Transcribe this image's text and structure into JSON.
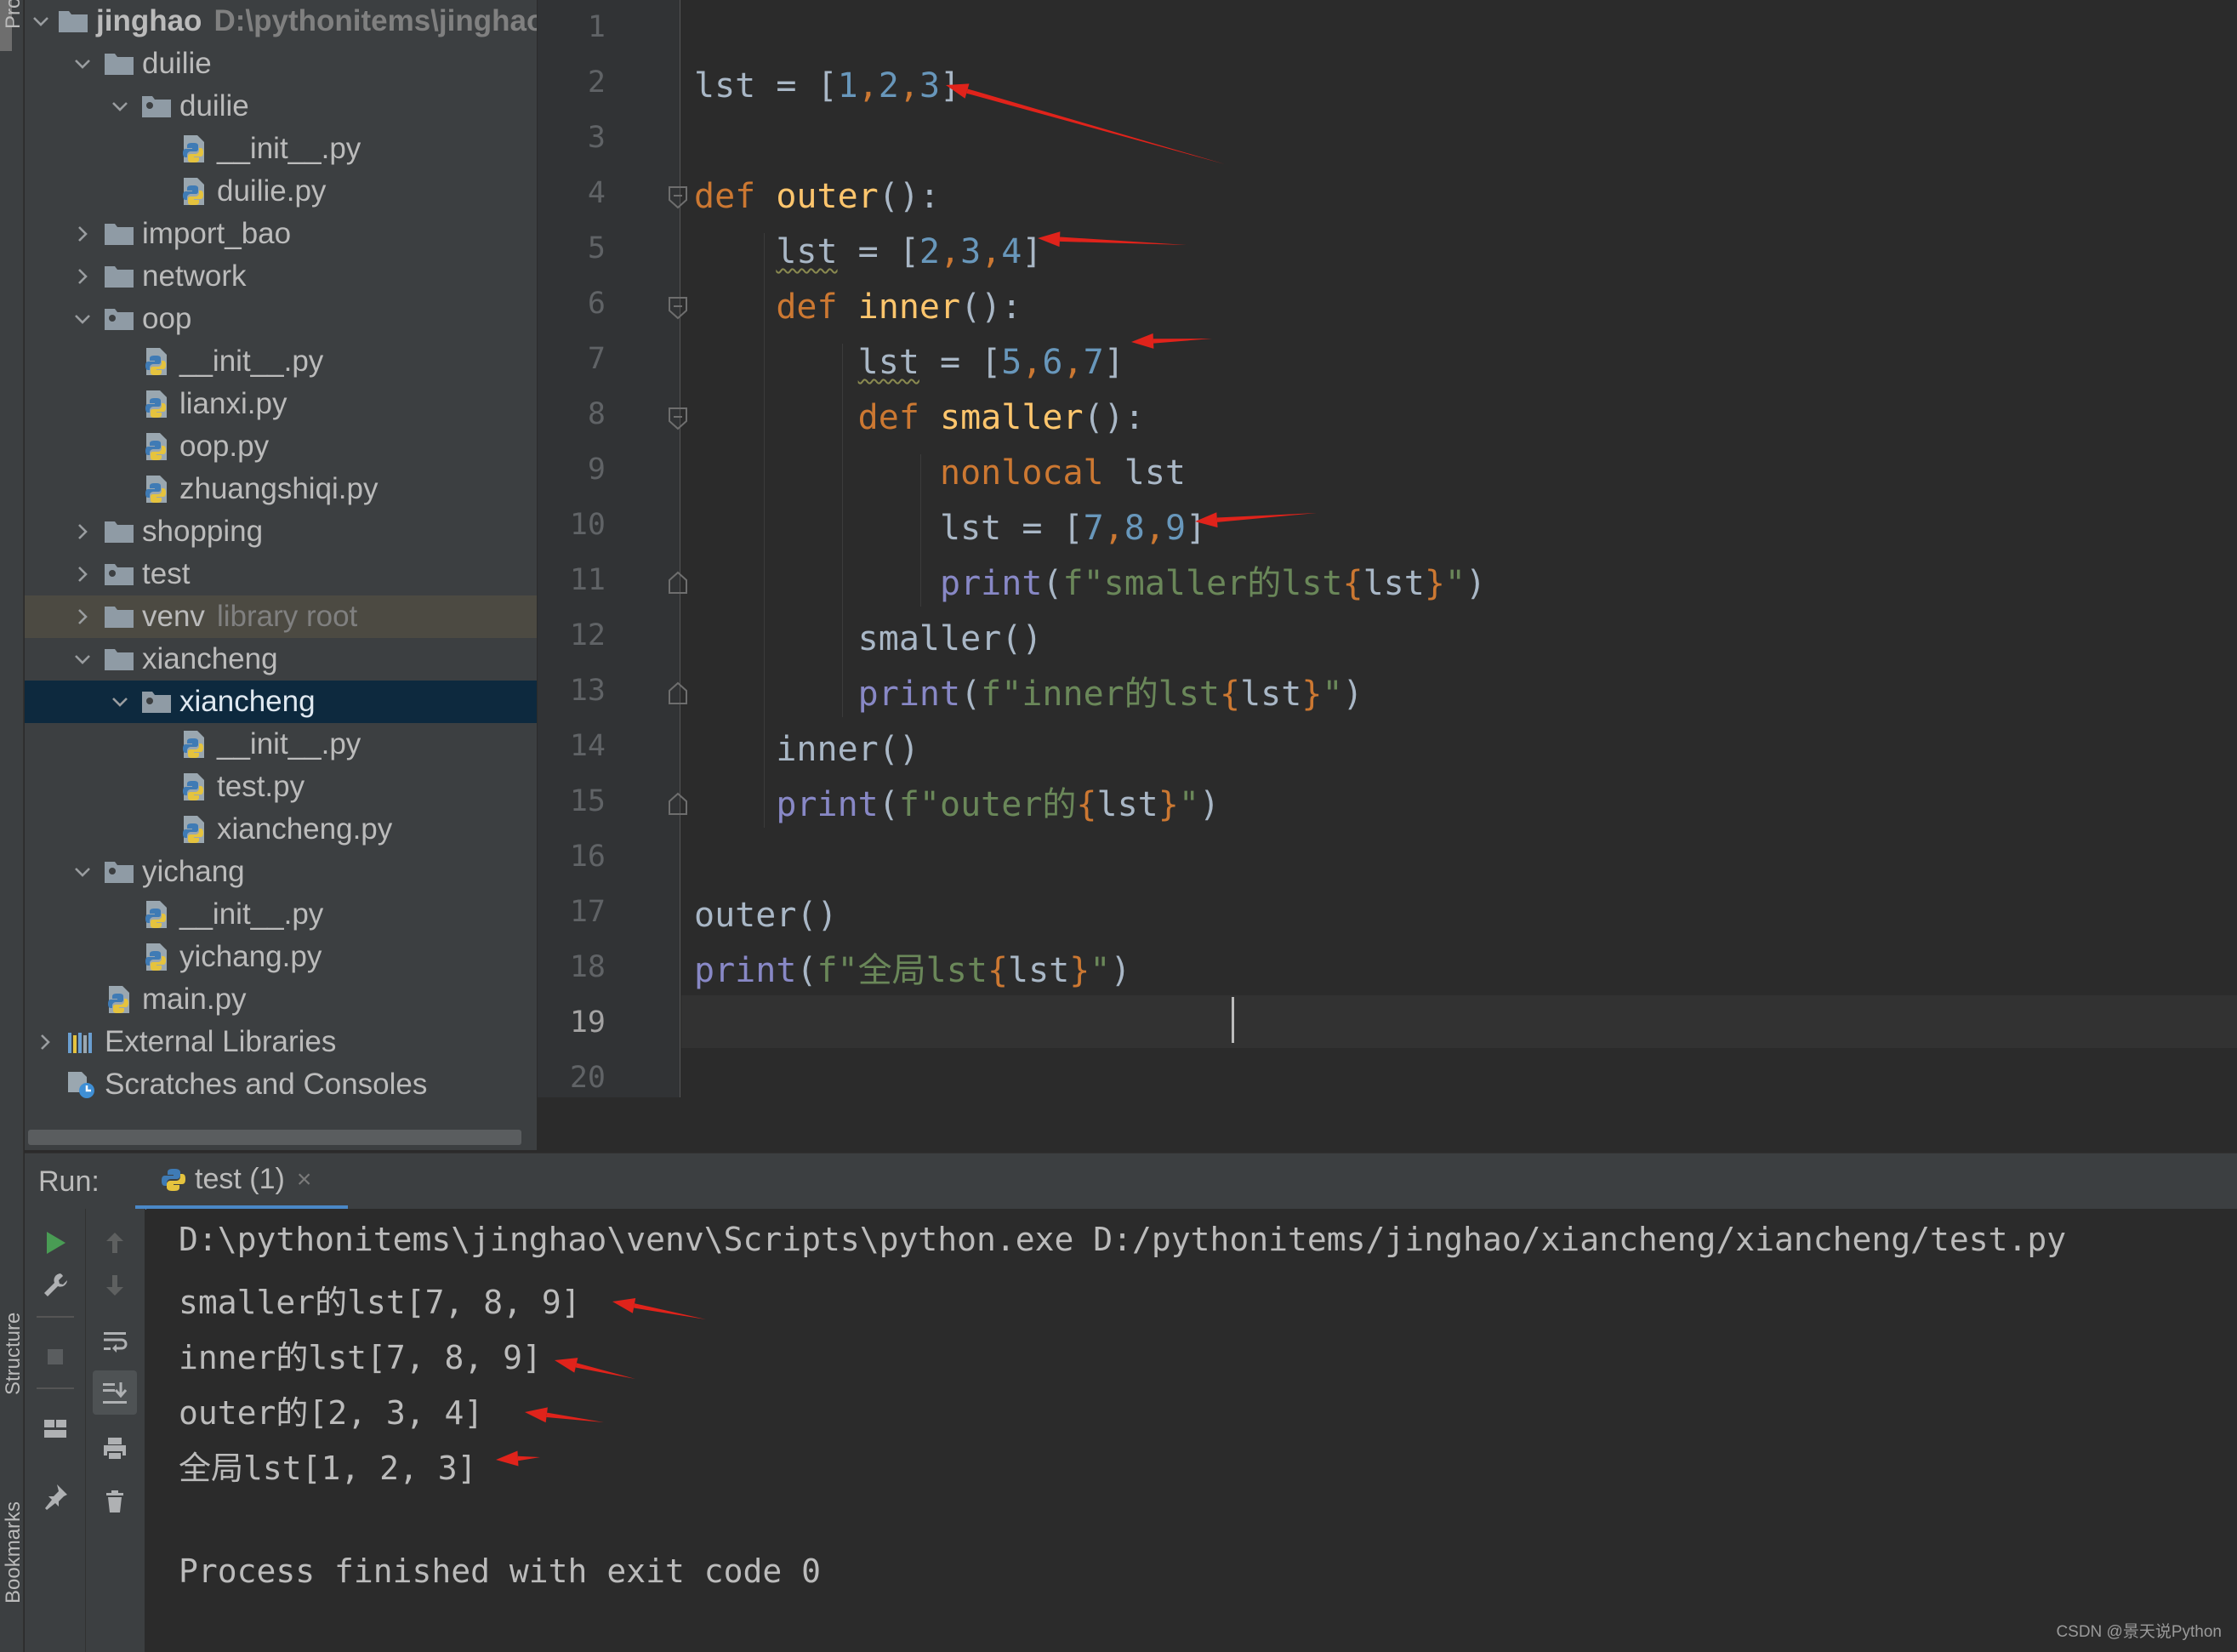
{
  "side_strip": {
    "project_label": "Pro",
    "structure_label": "Structure",
    "bookmarks_label": "Bookmarks"
  },
  "project_tree": {
    "rows": [
      {
        "label": "jinghao",
        "hint": "D:\\pythonitems\\jinghao",
        "kind": "project-root",
        "expanded": true
      },
      {
        "label": "duilie",
        "kind": "folder",
        "expanded": true
      },
      {
        "label": "duilie",
        "kind": "package",
        "expanded": true
      },
      {
        "label": "__init__.py",
        "kind": "python-file"
      },
      {
        "label": "duilie.py",
        "kind": "python-file"
      },
      {
        "label": "import_bao",
        "kind": "folder",
        "expanded": false
      },
      {
        "label": "network",
        "kind": "folder",
        "expanded": false
      },
      {
        "label": "oop",
        "kind": "package",
        "expanded": true
      },
      {
        "label": "__init__.py",
        "kind": "python-file"
      },
      {
        "label": "lianxi.py",
        "kind": "python-file"
      },
      {
        "label": "oop.py",
        "kind": "python-file"
      },
      {
        "label": "zhuangshiqi.py",
        "kind": "python-file"
      },
      {
        "label": "shopping",
        "kind": "folder",
        "expanded": false
      },
      {
        "label": "test",
        "kind": "package",
        "expanded": false
      },
      {
        "label": "venv",
        "hint": "library root",
        "kind": "folder",
        "expanded": false
      },
      {
        "label": "xiancheng",
        "kind": "folder",
        "expanded": true
      },
      {
        "label": "xiancheng",
        "kind": "package",
        "expanded": true,
        "selected": true
      },
      {
        "label": "__init__.py",
        "kind": "python-file"
      },
      {
        "label": "test.py",
        "kind": "python-file"
      },
      {
        "label": "xiancheng.py",
        "kind": "python-file"
      },
      {
        "label": "yichang",
        "kind": "package",
        "expanded": true
      },
      {
        "label": "__init__.py",
        "kind": "python-file"
      },
      {
        "label": "yichang.py",
        "kind": "python-file"
      },
      {
        "label": "main.py",
        "kind": "python-file"
      },
      {
        "label": "External Libraries",
        "kind": "libraries",
        "expanded": false
      },
      {
        "label": "Scratches and Consoles",
        "kind": "scratches"
      }
    ]
  },
  "editor": {
    "line_numbers": [
      "1",
      "2",
      "3",
      "4",
      "5",
      "6",
      "7",
      "8",
      "9",
      "10",
      "11",
      "12",
      "13",
      "14",
      "15",
      "16",
      "17",
      "18",
      "19",
      "20"
    ],
    "current_line": "19",
    "lines": [
      {
        "tokens": []
      },
      {
        "tokens": [
          {
            "t": "lst = [",
            "c": "var"
          },
          {
            "t": "1",
            "c": "num"
          },
          {
            "t": ",",
            "c": "kw"
          },
          {
            "t": "2",
            "c": "num"
          },
          {
            "t": ",",
            "c": "kw"
          },
          {
            "t": "3",
            "c": "num"
          },
          {
            "t": "]",
            "c": "var"
          }
        ]
      },
      {
        "tokens": []
      },
      {
        "tokens": [
          {
            "t": "def ",
            "c": "kw"
          },
          {
            "t": "outer",
            "c": "fn"
          },
          {
            "t": "():",
            "c": "var"
          }
        ]
      },
      {
        "tokens": [
          {
            "t": "    ",
            "c": "var"
          },
          {
            "t": "lst",
            "c": "var squig"
          },
          {
            "t": " = [",
            "c": "var"
          },
          {
            "t": "2",
            "c": "num"
          },
          {
            "t": ",",
            "c": "kw"
          },
          {
            "t": "3",
            "c": "num"
          },
          {
            "t": ",",
            "c": "kw"
          },
          {
            "t": "4",
            "c": "num"
          },
          {
            "t": "]",
            "c": "var"
          }
        ]
      },
      {
        "tokens": [
          {
            "t": "    ",
            "c": "var"
          },
          {
            "t": "def ",
            "c": "kw"
          },
          {
            "t": "inner",
            "c": "fn"
          },
          {
            "t": "():",
            "c": "var"
          }
        ]
      },
      {
        "tokens": [
          {
            "t": "        ",
            "c": "var"
          },
          {
            "t": "lst",
            "c": "var squig"
          },
          {
            "t": " = [",
            "c": "var"
          },
          {
            "t": "5",
            "c": "num"
          },
          {
            "t": ",",
            "c": "kw"
          },
          {
            "t": "6",
            "c": "num"
          },
          {
            "t": ",",
            "c": "kw"
          },
          {
            "t": "7",
            "c": "num"
          },
          {
            "t": "]",
            "c": "var"
          }
        ]
      },
      {
        "tokens": [
          {
            "t": "        ",
            "c": "var"
          },
          {
            "t": "def ",
            "c": "kw"
          },
          {
            "t": "smaller",
            "c": "fn"
          },
          {
            "t": "():",
            "c": "var"
          }
        ]
      },
      {
        "tokens": [
          {
            "t": "            ",
            "c": "var"
          },
          {
            "t": "nonlocal ",
            "c": "kw"
          },
          {
            "t": "lst",
            "c": "var"
          }
        ]
      },
      {
        "tokens": [
          {
            "t": "            lst = [",
            "c": "var"
          },
          {
            "t": "7",
            "c": "num"
          },
          {
            "t": ",",
            "c": "kw"
          },
          {
            "t": "8",
            "c": "num"
          },
          {
            "t": ",",
            "c": "kw"
          },
          {
            "t": "9",
            "c": "num"
          },
          {
            "t": "]",
            "c": "var"
          }
        ]
      },
      {
        "tokens": [
          {
            "t": "            ",
            "c": "var"
          },
          {
            "t": "print",
            "c": "bi"
          },
          {
            "t": "(",
            "c": "var"
          },
          {
            "t": "f\"smaller的lst",
            "c": "str"
          },
          {
            "t": "{",
            "c": "brace"
          },
          {
            "t": "lst",
            "c": "var"
          },
          {
            "t": "}",
            "c": "brace"
          },
          {
            "t": "\"",
            "c": "str"
          },
          {
            "t": ")",
            "c": "var"
          }
        ]
      },
      {
        "tokens": [
          {
            "t": "        smaller()",
            "c": "var"
          }
        ]
      },
      {
        "tokens": [
          {
            "t": "        ",
            "c": "var"
          },
          {
            "t": "print",
            "c": "bi"
          },
          {
            "t": "(",
            "c": "var"
          },
          {
            "t": "f\"inner的lst",
            "c": "str"
          },
          {
            "t": "{",
            "c": "brace"
          },
          {
            "t": "lst",
            "c": "var"
          },
          {
            "t": "}",
            "c": "brace"
          },
          {
            "t": "\"",
            "c": "str"
          },
          {
            "t": ")",
            "c": "var"
          }
        ]
      },
      {
        "tokens": [
          {
            "t": "    inner()",
            "c": "var"
          }
        ]
      },
      {
        "tokens": [
          {
            "t": "    ",
            "c": "var"
          },
          {
            "t": "print",
            "c": "bi"
          },
          {
            "t": "(",
            "c": "var"
          },
          {
            "t": "f\"outer的",
            "c": "str"
          },
          {
            "t": "{",
            "c": "brace"
          },
          {
            "t": "lst",
            "c": "var"
          },
          {
            "t": "}",
            "c": "brace"
          },
          {
            "t": "\"",
            "c": "str"
          },
          {
            "t": ")",
            "c": "var"
          }
        ]
      },
      {
        "tokens": []
      },
      {
        "tokens": [
          {
            "t": "outer()",
            "c": "var"
          }
        ]
      },
      {
        "tokens": [
          {
            "t": "print",
            "c": "bi"
          },
          {
            "t": "(",
            "c": "var"
          },
          {
            "t": "f\"全局lst",
            "c": "str"
          },
          {
            "t": "{",
            "c": "brace"
          },
          {
            "t": "lst",
            "c": "var"
          },
          {
            "t": "}",
            "c": "brace"
          },
          {
            "t": "\"",
            "c": "str"
          },
          {
            "t": ")",
            "c": "var"
          }
        ]
      },
      {
        "tokens": []
      },
      {
        "tokens": []
      }
    ]
  },
  "run_panel": {
    "title": "Run:",
    "tab_label": "test (1)",
    "tab_close": "×",
    "output_lines": [
      "D:\\pythonitems\\jinghao\\venv\\Scripts\\python.exe D:/pythonitems/jinghao/xiancheng/xiancheng/test.py",
      "smaller的lst[7, 8, 9]",
      "inner的lst[7, 8, 9]",
      "outer的[2, 3, 4]",
      "全局lst[1, 2, 3]",
      "",
      "Process finished with exit code 0"
    ]
  },
  "colors": {
    "annotation_arrow": "#e0231b",
    "run_icon": "#499c54",
    "tab_underline": "#4a88c7"
  },
  "watermark": "CSDN @景天说Python"
}
